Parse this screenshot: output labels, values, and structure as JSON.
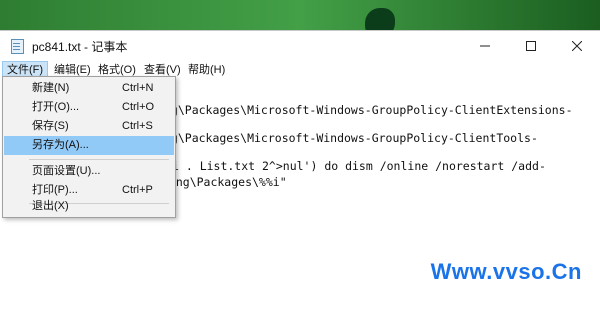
{
  "window": {
    "title": "pc841.txt - 记事本"
  },
  "menubar": {
    "items": [
      {
        "label": "文件(F)"
      },
      {
        "label": "编辑(E)"
      },
      {
        "label": "格式(O)"
      },
      {
        "label": "查看(V)"
      },
      {
        "label": "帮助(H)"
      }
    ]
  },
  "file_menu": {
    "items": [
      {
        "label": "新建(N)",
        "shortcut": "Ctrl+N"
      },
      {
        "label": "打开(O)...",
        "shortcut": "Ctrl+O"
      },
      {
        "label": "保存(S)",
        "shortcut": "Ctrl+S"
      },
      {
        "label": "另存为(A)...",
        "shortcut": ""
      },
      {
        "label": "页面设置(U)...",
        "shortcut": ""
      },
      {
        "label": "打印(P)...",
        "shortcut": "Ctrl+P"
      },
      {
        "label": "退出(X)",
        "shortcut": ""
      }
    ],
    "highlighted_item": "另存为(A)..."
  },
  "editor": {
    "lines": [
      "ng\\Packages\\Microsoft-Windows-GroupPolicy-ClientExtensions-",
      "ng\\Packages\\Microsoft-Windows-GroupPolicy-ClientTools-",
      "i . List.txt 2^>nul') do dism /online /norestart /add-",
      "cing\\Packages\\%%i\""
    ]
  },
  "watermark": {
    "text": "Www.vvso.Cn"
  },
  "colors": {
    "menu_highlight": "#91c9f7",
    "menu_active": "#cce4f7",
    "watermark": "#1a73e8",
    "desktop": "#2d8a4e"
  }
}
